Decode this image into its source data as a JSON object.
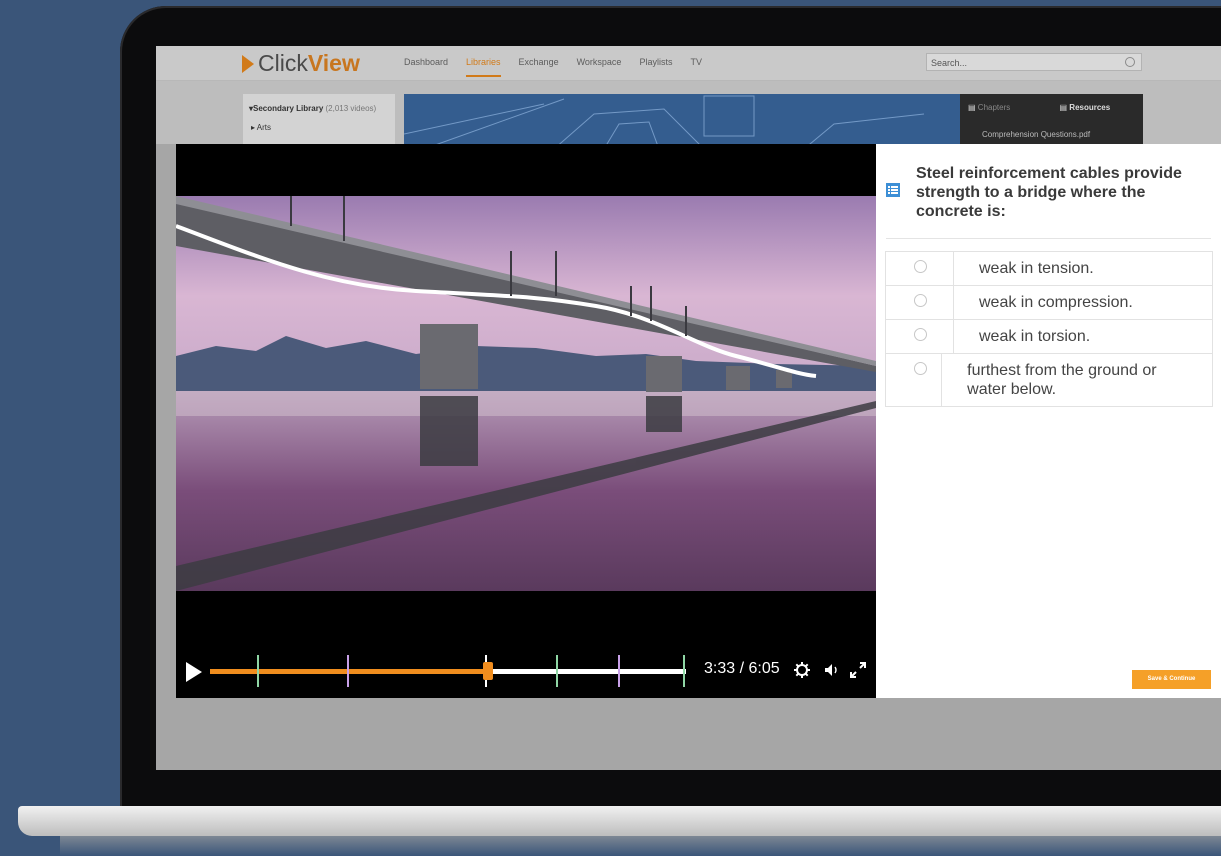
{
  "app": {
    "logo_part1": "Click",
    "logo_part2": "View",
    "nav": [
      {
        "label": "Dashboard",
        "active": false
      },
      {
        "label": "Libraries",
        "active": true
      },
      {
        "label": "Exchange",
        "active": false
      },
      {
        "label": "Workspace",
        "active": false
      },
      {
        "label": "Playlists",
        "active": false
      },
      {
        "label": "TV",
        "active": false
      }
    ],
    "search_placeholder": "Search...",
    "accent_color": "#d17a19"
  },
  "sidebar": {
    "library_title": "Secondary Library",
    "library_count": "(2,013 videos)",
    "first_item": "Arts"
  },
  "resources_panel": {
    "tab_chapters": "Chapters",
    "tab_resources": "Resources",
    "file_1": "Comprehension Questions.pdf"
  },
  "player": {
    "current_time": "3:33",
    "total_time": "6:05",
    "time_display": "3:33 / 6:05",
    "progress_fraction": 0.584,
    "progress_color": "#f08d1e",
    "markers": [
      {
        "fraction": 0.1,
        "color": "#8fd6a5"
      },
      {
        "fraction": 0.29,
        "color": "#c8a0e8"
      },
      {
        "fraction": 0.58,
        "color": "#ffffff"
      },
      {
        "fraction": 0.73,
        "color": "#8fd6a5"
      },
      {
        "fraction": 0.86,
        "color": "#c8a0e8"
      },
      {
        "fraction": 0.995,
        "color": "#8fd6a5"
      }
    ],
    "icons": [
      "play-icon",
      "gear-icon",
      "volume-icon",
      "fullscreen-icon"
    ]
  },
  "quiz": {
    "question": "Steel reinforcement cables provide strength to a bridge where the concrete is:",
    "answers": [
      "weak in tension.",
      "weak in compression.",
      "weak in torsion.",
      "furthest from the ground or water below."
    ],
    "save_label": "Save & Continue",
    "save_color": "#f5a028"
  }
}
